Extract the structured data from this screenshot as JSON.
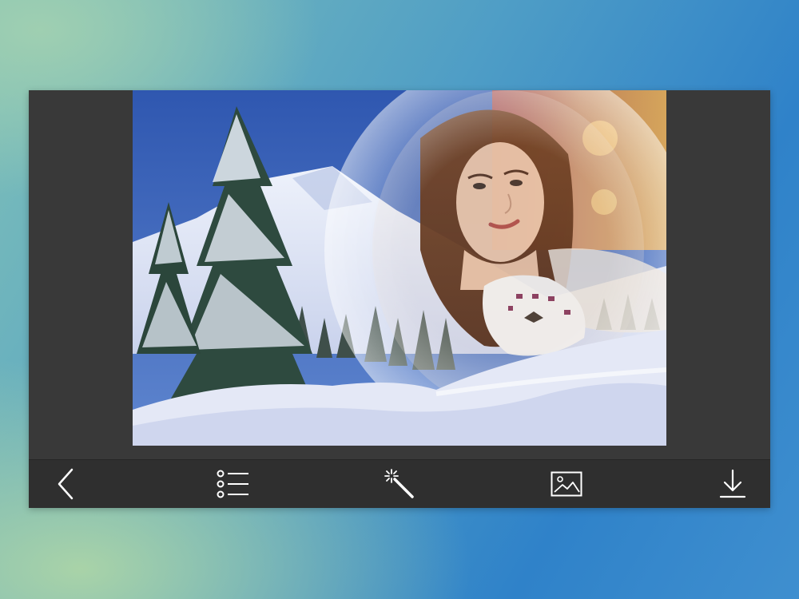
{
  "editor": {
    "photo": {
      "description_icon": "winter-portrait-frame-photo"
    }
  },
  "toolbar": {
    "buttons": [
      {
        "icon": "chevron-left-icon",
        "name": "back-button"
      },
      {
        "icon": "list-icon",
        "name": "frames-list-button"
      },
      {
        "icon": "magic-wand-icon",
        "name": "effects-button"
      },
      {
        "icon": "image-icon",
        "name": "gallery-button"
      },
      {
        "icon": "download-icon",
        "name": "save-button"
      }
    ]
  },
  "colors": {
    "toolbar_bg": "#2f2f2f",
    "frame_bg": "#393939",
    "icon_color": "#ffffff"
  }
}
